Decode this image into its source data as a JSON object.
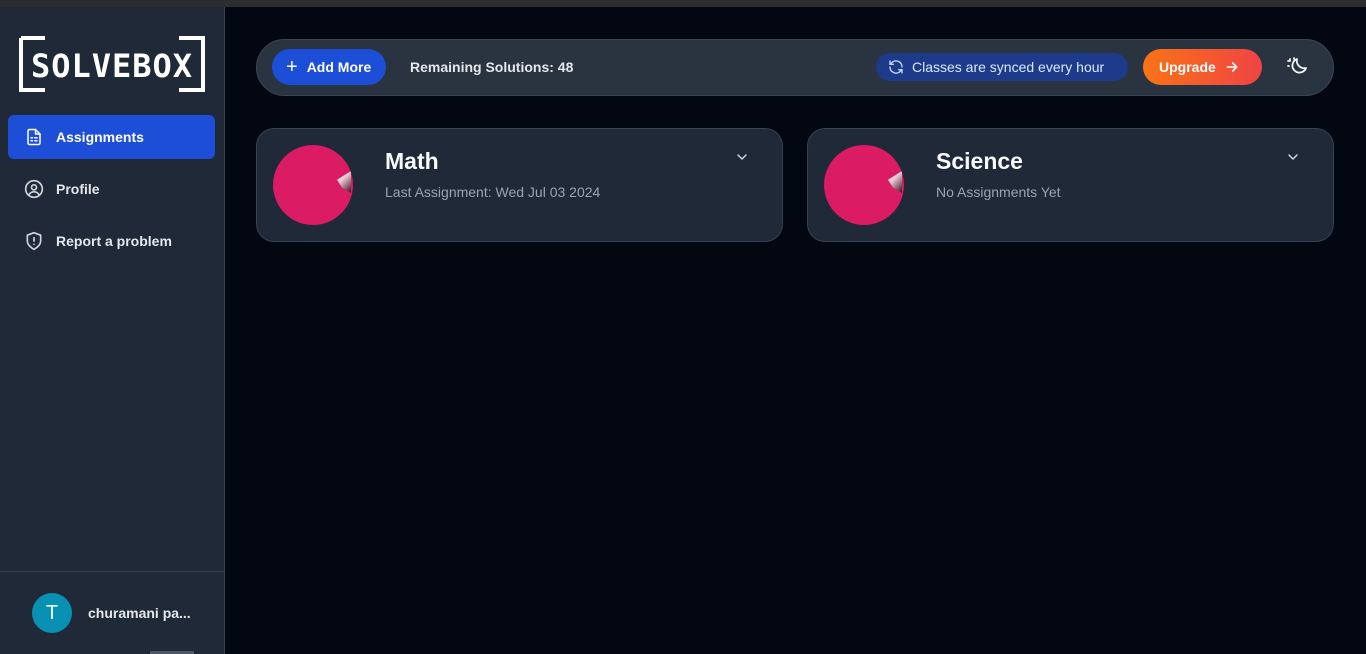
{
  "app": {
    "logo_text": "SOLVEBOX"
  },
  "sidebar": {
    "items": [
      {
        "label": "Assignments",
        "icon": "document-list-icon",
        "active": true
      },
      {
        "label": "Profile",
        "icon": "user-circle-icon",
        "active": false
      },
      {
        "label": "Report a problem",
        "icon": "shield-alert-icon",
        "active": false
      }
    ],
    "user": {
      "initial": "T",
      "name": "churamani pa..."
    }
  },
  "topbar": {
    "add_label": "Add More",
    "remaining": "Remaining Solutions: 48",
    "sync_text": "Classes are synced every hour",
    "upgrade_label": "Upgrade",
    "theme_icon": "moon-sun-icon"
  },
  "classes": [
    {
      "name": "Math",
      "subtitle": "Last Assignment: Wed Jul 03 2024"
    },
    {
      "name": "Science",
      "subtitle": "No Assignments Yet"
    }
  ],
  "colors": {
    "accent": "#1d4ed8",
    "upgrade_start": "#f97316",
    "upgrade_end": "#ef4444",
    "class_circle": "#db1b63",
    "avatar": "#0891b2"
  }
}
